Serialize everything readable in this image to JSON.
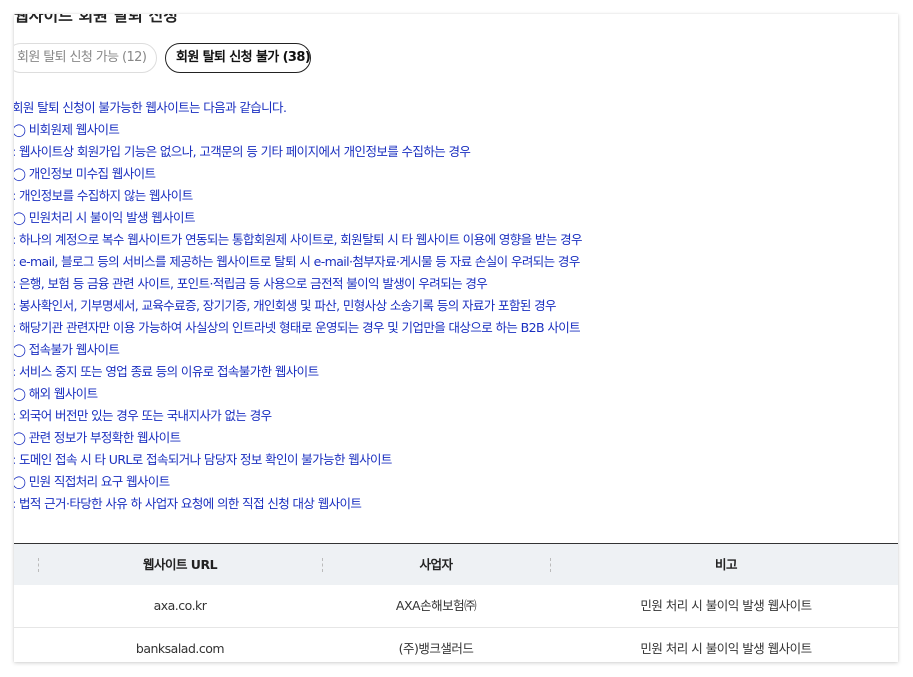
{
  "page": {
    "title": "웹사이트 회원 탈퇴 신청"
  },
  "tabs": [
    {
      "label": "회원 탈퇴 신청 가능 (12)",
      "active": false
    },
    {
      "label": "회원 탈퇴 신청 불가 (38)",
      "active": true
    }
  ],
  "notice": [
    "회원 탈퇴 신청이 불가능한 웹사이트는 다음과 같습니다.",
    "◯ 비회원제 웹사이트",
    ": 웹사이트상 회원가입 기능은 없으나, 고객문의 등 기타 페이지에서 개인정보를 수집하는 경우",
    "◯ 개인정보 미수집 웹사이트",
    ": 개인정보를 수집하지 않는 웹사이트",
    "◯ 민원처리 시 불이익 발생 웹사이트",
    ": 하나의 계정으로 복수 웹사이트가 연동되는 통합회원제 사이트로, 회원탈퇴 시 타 웹사이트 이용에 영향을 받는 경우",
    ": e-mail, 블로그 등의 서비스를 제공하는 웹사이트로 탈퇴 시 e-mail·첨부자료·게시물 등 자료 손실이 우려되는 경우",
    ": 은행, 보험 등 금융 관련 사이트, 포인트·적립금 등 사용으로 금전적 불이익 발생이 우려되는 경우",
    ": 봉사확인서, 기부명세서, 교육수료증, 장기기증, 개인회생 및 파산, 민형사상 소송기록 등의 자료가 포함된 경우",
    ": 해당기관 관련자만 이용 가능하여 사실상의 인트라넷 형태로 운영되는 경우 및 기업만을 대상으로 하는 B2B 사이트",
    "◯ 접속불가 웹사이트",
    ": 서비스 중지 또는 영업 종료 등의 이유로 접속불가한 웹사이트",
    "◯ 해외 웹사이트",
    ": 외국어 버전만 있는 경우 또는 국내지사가 없는 경우",
    "◯ 관련 정보가 부정확한 웹사이트",
    ": 도메인 접속 시 타 URL로 접속되거나 담당자 정보 확인이 불가능한 웹사이트",
    "◯ 민원 직접처리 요구 웹사이트",
    ": 법적 근거·타당한 사유 하 사업자 요청에 의한 직접 신청 대상 웹사이트"
  ],
  "table": {
    "headers": [
      "웹사이트 URL",
      "사업자",
      "비고"
    ],
    "rows": [
      [
        "axa.co.kr",
        "AXA손해보험㈜",
        "민원 처리 시 불이익 발생 웹사이트"
      ],
      [
        "banksalad.com",
        "(주)뱅크샐러드",
        "민원 처리 시 불이익 발생 웹사이트"
      ]
    ]
  },
  "colors": {
    "notice_text": "#1a2fc0",
    "header_bg": "#eef1f4",
    "active_tab_border": "#222222"
  }
}
